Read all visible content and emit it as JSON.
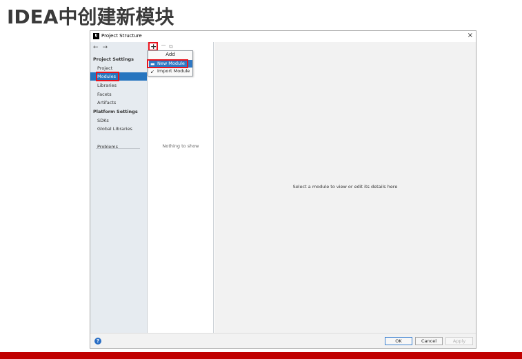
{
  "slide": {
    "title": "IDEA中创建新模块"
  },
  "dialog": {
    "title": "Project Structure",
    "app_icon_text": "IJ",
    "close_glyph": "×",
    "nav": {
      "back": "←",
      "forward": "→"
    },
    "sidebar": {
      "project_settings_header": "Project Settings",
      "project_settings_items": [
        "Project",
        "Modules",
        "Libraries",
        "Facets",
        "Artifacts"
      ],
      "selected_item": "Modules",
      "platform_settings_header": "Platform Settings",
      "platform_settings_items": [
        "SDKs",
        "Global Libraries"
      ],
      "problems": "Problems"
    },
    "toolbar": {
      "add": "+",
      "remove": "−",
      "copy": "⧉"
    },
    "middle": {
      "empty_text": "Nothing to show"
    },
    "add_popup": {
      "header": "Add",
      "items": [
        {
          "label": "New Module",
          "icon": "folder-icon",
          "active": true
        },
        {
          "label": "Import Module",
          "icon": "import-icon",
          "active": false
        }
      ]
    },
    "content": {
      "hint": "Select a module to view or edit its details here"
    },
    "footer": {
      "help": "?",
      "ok": "OK",
      "cancel": "Cancel",
      "apply": "Apply"
    }
  },
  "colors": {
    "accent": "#2675bf",
    "highlight": "#e8141e",
    "bottom_bar": "#c00000"
  }
}
